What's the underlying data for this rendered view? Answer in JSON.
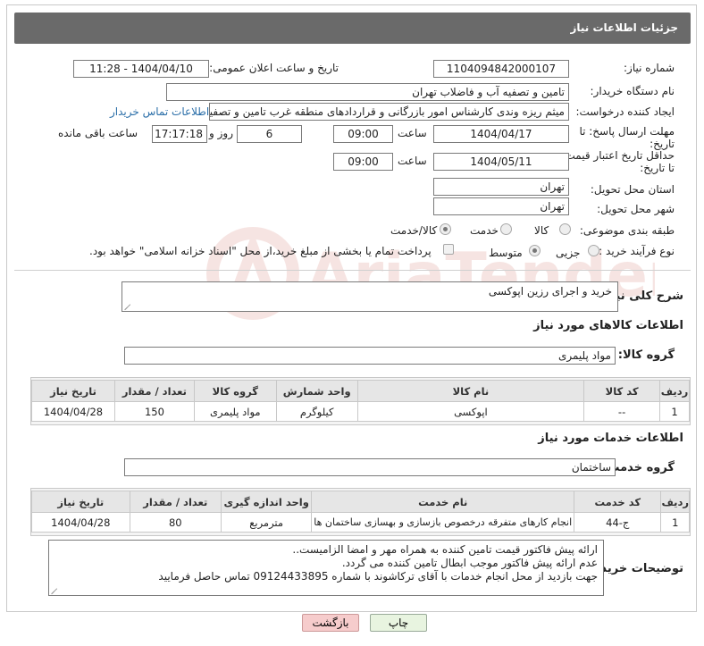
{
  "header": {
    "title": "جزئیات اطلاعات نیاز"
  },
  "fields": {
    "need_number": {
      "label": "شماره نیاز:",
      "value": "1104094842000107"
    },
    "announce_datetime": {
      "label": "تاریخ و ساعت اعلان عمومی:",
      "value": "1404/04/10 - 11:28"
    },
    "buyer_org": {
      "label": "نام دستگاه خریدار:",
      "value": "تامین و تصفیه آب و فاضلاب تهران"
    },
    "requester": {
      "label": "ایجاد کننده درخواست:",
      "value": "میثم ریزه وندی کارشناس امور بازرگانی و قراردادهای منطقه غرب تامین و تصفیه",
      "contact_link": "اطلاعات تماس خریدار"
    },
    "reply_deadline": {
      "label_line1": "مهلت ارسال پاسخ: تا",
      "label_line2": "تاریخ:",
      "date": "1404/04/17",
      "time_label": "ساعت",
      "time": "09:00",
      "days": "6",
      "days_label": "روز و",
      "remaining_time": "17:17:18",
      "remaining_label": "ساعت باقی مانده"
    },
    "price_validity": {
      "label_line1": "حداقل تاریخ اعتبار قیمت:",
      "label_line2": "تا تاریخ:",
      "date": "1404/05/11",
      "time_label": "ساعت",
      "time": "09:00"
    },
    "delivery_province": {
      "label": "استان محل تحویل:",
      "value": "تهران"
    },
    "delivery_city": {
      "label": "شهر محل تحویل:",
      "value": "تهران"
    },
    "category": {
      "label": "طبقه بندی موضوعی:",
      "options": [
        "کالا",
        "خدمت",
        "کالا/خدمت"
      ],
      "selected": "کالا/خدمت"
    },
    "purchase_process": {
      "label": "نوع فرآیند خرید :",
      "options": [
        "جزیی",
        "متوسط"
      ],
      "selected": "متوسط",
      "payment_note": "پرداخت تمام یا بخشی از مبلغ خرید،از محل \"اسناد خزانه اسلامی\" خواهد بود."
    }
  },
  "description": {
    "label": "شرح کلی نیاز:",
    "value": "خرید و اجرای رزین اپوکسی"
  },
  "goods_section": {
    "title": "اطلاعات کالاهای مورد نیاز",
    "group_label": "گروه کالا:",
    "group_value": "مواد پلیمری",
    "columns": [
      "ردیف",
      "کد کالا",
      "نام کالا",
      "واحد شمارش",
      "گروه کالا",
      "تعداد / مقدار",
      "تاریخ نیاز"
    ],
    "rows": [
      [
        "1",
        "--",
        "اپوکسی",
        "کیلوگرم",
        "مواد پلیمری",
        "150",
        "1404/04/28"
      ]
    ]
  },
  "services_section": {
    "title": "اطلاعات خدمات مورد نیاز",
    "group_label": "گروه خدمت:",
    "group_value": "ساختمان",
    "columns": [
      "ردیف",
      "کد خدمت",
      "نام خدمت",
      "واحد اندازه گیری",
      "تعداد / مقدار",
      "تاریخ نیاز"
    ],
    "rows": [
      [
        "1",
        "ج-44",
        "انجام کارهای متفرقه درخصوص بازسازی و بهسازی ساختمان ها",
        "مترمربع",
        "80",
        "1404/04/28"
      ]
    ]
  },
  "buyer_notes": {
    "label": "توضیحات خریدار:",
    "lines": [
      "ارائه پیش فاکتور قیمت تامین کننده به همراه مهر و امضا الزامیست..",
      "عدم ارائه پیش فاکتور موجب ابطال تامین کننده می گردد.",
      "جهت بازدید از محل انجام خدمات با آقای ترکاشوند با شماره 09124433895 تماس حاصل فرمایید"
    ]
  },
  "buttons": {
    "print": "چاپ",
    "back": "بازگشت"
  },
  "watermark": {
    "text": "AriaTender.neT"
  },
  "colors": {
    "header_bg": "#6a6a6a",
    "link": "#2a6ea8",
    "back_button": "#f6cccc",
    "print_button": "#e8f4e0",
    "watermark": "#c0392b"
  }
}
